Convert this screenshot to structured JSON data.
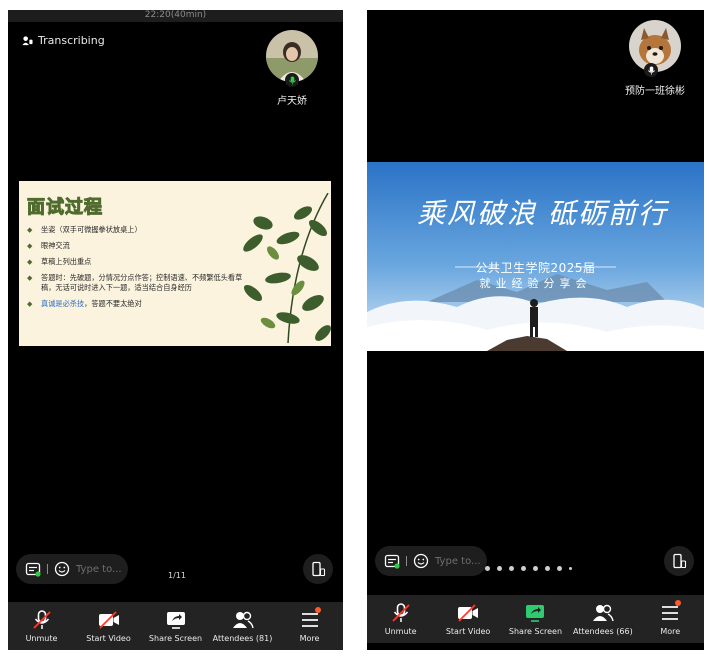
{
  "left": {
    "status_time": "22:20(40min)",
    "transcribing": "Transcribing",
    "participant": {
      "name": "卢天娇"
    },
    "slide": {
      "title": "面试过程",
      "items": [
        {
          "text": "坐姿（双手可微握拳状放桌上）"
        },
        {
          "text": "眼神交流"
        },
        {
          "text": "草稿上列出重点"
        },
        {
          "text": "答题时：先破题，分情况分点作答；控制语速、不频繁低头看草稿，无话可说时进入下一题，适当结合自身经历"
        },
        {
          "text_highlight": "真诚是必杀技",
          "text_rest": "，答题不要太绝对"
        }
      ]
    },
    "page_indicator": "1/11",
    "chat_placeholder": "Type to...",
    "toolbar": {
      "unmute": "Unmute",
      "start_video": "Start Video",
      "share_screen": "Share Screen",
      "attendees": "Attendees (81)",
      "more": "More"
    }
  },
  "right": {
    "participant": {
      "name": "预防一班徐彬"
    },
    "slide": {
      "calligraphy": "乘风破浪 砥砺前行",
      "subtitle": "公共卫生学院2025届",
      "subtitle2": "就业经验分享会"
    },
    "chat_placeholder": "Type to...",
    "toolbar": {
      "unmute": "Unmute",
      "start_video": "Start Video",
      "share_screen": "Share Screen",
      "attendees": "Attendees (66)",
      "more": "More"
    }
  },
  "colors": {
    "screen_bg": "#000000",
    "toolbar_bg": "#232323",
    "mic_active": "#2ecc40",
    "share_green": "#2ecc71",
    "notif": "#ff5a2e",
    "slide_cream": "#fbf3de",
    "slide_green": "#4f6b2e",
    "highlight_blue": "#2f6fc4"
  }
}
